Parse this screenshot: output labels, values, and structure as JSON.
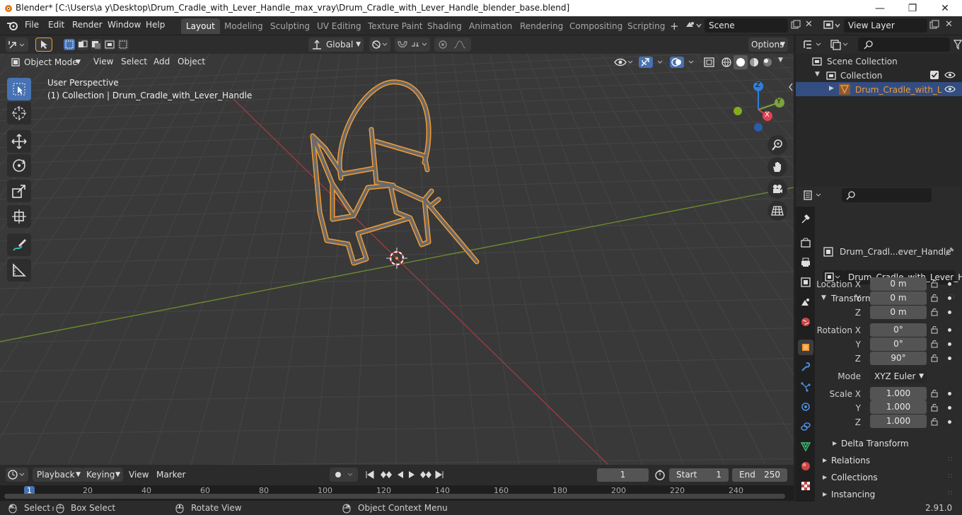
{
  "window": {
    "title": "Blender* [C:\\Users\\a y\\Desktop\\Drum_Cradle_with_Lever_Handle_max_vray\\Drum_Cradle_with_Lever_Handle_blender_base.blend]",
    "minimize": "—",
    "maximize": "❐",
    "close": "✕"
  },
  "menu": {
    "items": [
      "File",
      "Edit",
      "Render",
      "Window",
      "Help"
    ]
  },
  "workspaces": {
    "tabs": [
      "Layout",
      "Modeling",
      "Sculpting",
      "UV Editing",
      "Texture Paint",
      "Shading",
      "Animation",
      "Rendering",
      "Compositing",
      "Scripting"
    ],
    "active": "Layout",
    "add": "+"
  },
  "scene": {
    "name": "Scene",
    "view_layer": "View Layer"
  },
  "tool_header": {
    "orientation": "Global",
    "options": "Options"
  },
  "viewport_header": {
    "mode": "Object Mode",
    "menus": [
      "View",
      "Select",
      "Add",
      "Object"
    ]
  },
  "viewport": {
    "perspective": "User Perspective",
    "collection_info": "(1) Collection | Drum_Cradle_with_Lever_Handle",
    "gizmo": {
      "x": "X",
      "y": "Y",
      "z": "Z"
    }
  },
  "outliner": {
    "root": "Scene Collection",
    "collection": "Collection",
    "object": "Drum_Cradle_with_L"
  },
  "properties": {
    "object_name": "Drum_Cradl...ever_Handle",
    "datablock": "Drum_Cradle_with_Lever_H...",
    "transform_title": "Transform",
    "location_label": "Location X",
    "rotation_label": "Rotation X",
    "scale_label": "Scale X",
    "y_label": "Y",
    "z_label": "Z",
    "location": [
      "0 m",
      "0 m",
      "0 m"
    ],
    "rotation": [
      "0°",
      "0°",
      "90°"
    ],
    "mode_label": "Mode",
    "mode": "XYZ Euler",
    "scale": [
      "1.000",
      "1.000",
      "1.000"
    ],
    "delta": "Delta Transform",
    "sections": [
      "Relations",
      "Collections",
      "Instancing"
    ]
  },
  "timeline": {
    "menus": [
      "Playback",
      "Keying",
      "View",
      "Marker"
    ],
    "current_frame": "1",
    "start_label": "Start",
    "start": "1",
    "end_label": "End",
    "end": "250",
    "ruler": [
      "1",
      "20",
      "40",
      "60",
      "80",
      "100",
      "120",
      "140",
      "160",
      "180",
      "200",
      "220",
      "240"
    ]
  },
  "statusbar": {
    "select": "Select",
    "box_select": "Box Select",
    "rotate_view": "Rotate View",
    "context_menu": "Object Context Menu",
    "version": "2.91.0"
  },
  "colors": {
    "accent": "#4772b3",
    "selection": "#f19b35",
    "x_axis": "#c8454f",
    "y_axis": "#7ba33b",
    "z_axis": "#2f7fdd"
  }
}
